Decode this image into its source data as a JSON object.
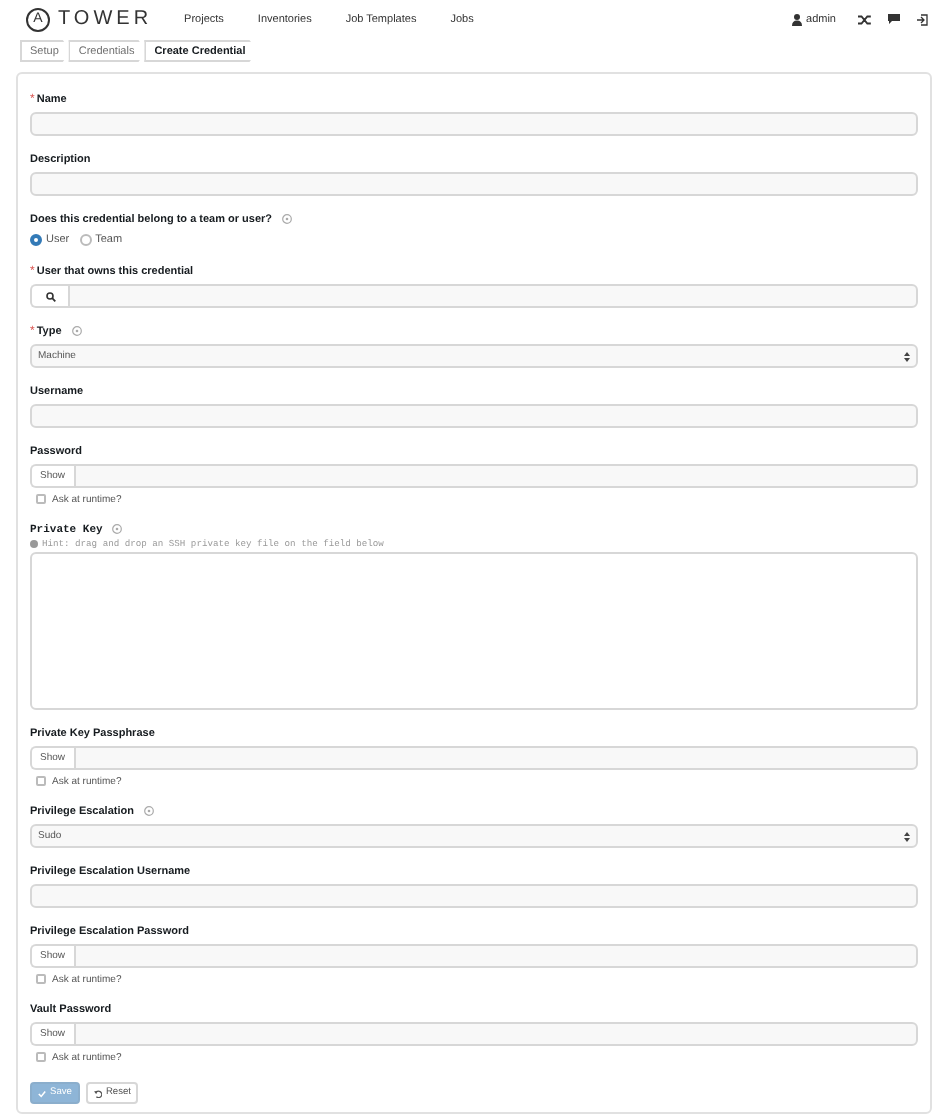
{
  "header": {
    "logo_mark": "A",
    "logo_text": "TOWER",
    "nav": [
      "Projects",
      "Inventories",
      "Job Templates",
      "Jobs"
    ],
    "user": "admin"
  },
  "breadcrumb": [
    {
      "label": "Setup",
      "selected": false
    },
    {
      "label": "Credentials",
      "selected": false
    },
    {
      "label": "Create Credential",
      "selected": true
    }
  ],
  "fields": [
    {
      "kind": "text",
      "required_mark": "*",
      "label": "Name",
      "help": false
    },
    {
      "kind": "text",
      "label": "Description",
      "help": false
    },
    {
      "kind": "radio",
      "label": "Does this credential belong to a team or user?",
      "help": true,
      "options": [
        {
          "label": "User",
          "selected": true
        },
        {
          "label": "Team",
          "selected": false
        }
      ]
    },
    {
      "kind": "lookup",
      "required_mark": "*",
      "label": "User that owns this credential",
      "help": false
    },
    {
      "kind": "select",
      "required_mark": "*",
      "label": "Type",
      "help": true,
      "value": "Machine"
    },
    {
      "kind": "text",
      "label": "Username",
      "help": false
    },
    {
      "kind": "password",
      "label": "Password",
      "help": false,
      "show": "Show",
      "ask": {
        "label": "Ask at runtime?",
        "checked": false
      }
    },
    {
      "kind": "textarea",
      "label": "Private Key",
      "help": true,
      "hint": "Hint: drag and drop an SSH private key file on the field below"
    },
    {
      "kind": "password",
      "label": "Private Key Passphrase",
      "help": false,
      "show": "Show",
      "ask": {
        "label": "Ask at runtime?",
        "checked": false
      }
    },
    {
      "kind": "select",
      "label": "Privilege Escalation",
      "help": true,
      "value": "Sudo"
    },
    {
      "kind": "text",
      "label": "Privilege Escalation Username",
      "help": false
    },
    {
      "kind": "password",
      "label": "Privilege Escalation Password",
      "help": false,
      "show": "Show",
      "ask": {
        "label": "Ask at runtime?",
        "checked": false
      }
    },
    {
      "kind": "password",
      "label": "Vault Password",
      "help": false,
      "show": "Show",
      "ask": {
        "label": "Ask at runtime?",
        "checked": false
      }
    }
  ],
  "buttons": [
    {
      "kind": "save",
      "label": "Save",
      "disabled": true
    },
    {
      "kind": "reset",
      "label": "Reset",
      "disabled": false
    }
  ]
}
